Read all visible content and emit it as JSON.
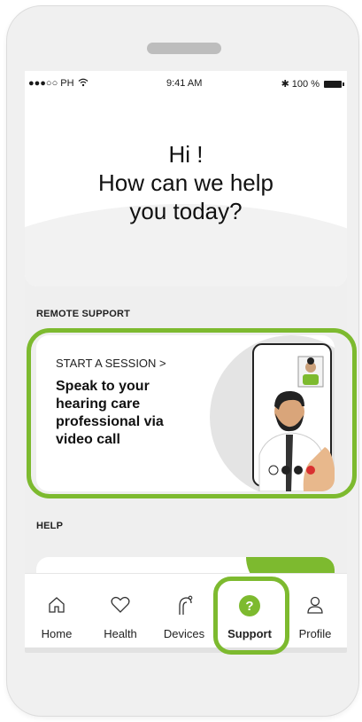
{
  "status_bar": {
    "carrier": "●●●○○ PH",
    "time": "9:41 AM",
    "battery": "100 %"
  },
  "greeting": {
    "line1": "Hi !",
    "line2": "How can we help",
    "line3": "you today?"
  },
  "remote_support": {
    "section_label": "REMOTE SUPPORT",
    "cta": "START A SESSION >",
    "description": "Speak to your hearing care professional via video call"
  },
  "help": {
    "section_label": "HELP"
  },
  "tabs": [
    {
      "label": "Home",
      "icon": "home-icon"
    },
    {
      "label": "Health",
      "icon": "heart-icon"
    },
    {
      "label": "Devices",
      "icon": "hearing-aid-icon"
    },
    {
      "label": "Support",
      "icon": "question-icon",
      "badge": "?",
      "selected": true
    },
    {
      "label": "Profile",
      "icon": "person-icon"
    }
  ],
  "colors": {
    "accent": "#7dba2f",
    "background": "#efefef"
  }
}
